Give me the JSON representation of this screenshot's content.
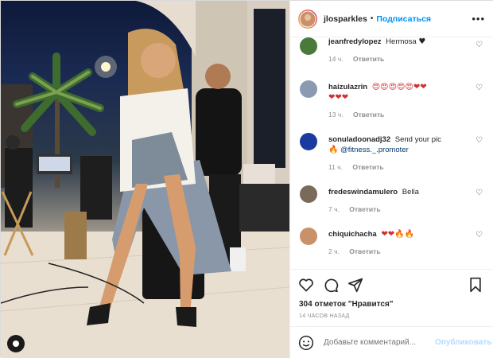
{
  "post": {
    "username": "jlosparkles",
    "follow_label": "Подписаться",
    "separator": "•",
    "more_label": "•••"
  },
  "comments": [
    {
      "user": "jeanfredylopez",
      "text": "Hermosa",
      "emoji": "♥",
      "time": "14 ч.",
      "reply": "Ответить",
      "avatar_color": "#4a7a3a"
    },
    {
      "user": "haizulazrin",
      "text": "",
      "emoji": "😍😍😍😍😍❤❤",
      "emoji2": "❤❤❤",
      "time": "13 ч.",
      "reply": "Ответить",
      "avatar_color": "#8a9ab0"
    },
    {
      "user": "sonuladoonadj32",
      "text": "Send your pic",
      "emoji": "🔥",
      "link": "@fitness._.promoter",
      "time": "11 ч.",
      "reply": "Ответить",
      "avatar_color": "#1a3aa0"
    },
    {
      "user": "fredeswindamulero",
      "text": "Bella",
      "emoji": "",
      "time": "7 ч.",
      "reply": "Ответить",
      "avatar_color": "#7a6a5a"
    },
    {
      "user": "chiquichacha",
      "text": "",
      "emoji": "❤❤🔥🔥",
      "time": "2 ч.",
      "reply": "Ответить",
      "avatar_color": "#c9906a"
    }
  ],
  "likes_text": "304 отметок \"Нравится\"",
  "timestamp": "14 ЧАСОВ НАЗАД",
  "comment_placeholder": "Добавьте комментарий...",
  "post_button": "Опубликовать",
  "icons": [
    "heart-icon",
    "comment-icon",
    "share-icon",
    "bookmark-icon",
    "smile-icon",
    "more-icon"
  ],
  "colors": {
    "accent": "#0095f6",
    "post_disabled": "#b3dbff",
    "muted": "#8e8e8e"
  }
}
